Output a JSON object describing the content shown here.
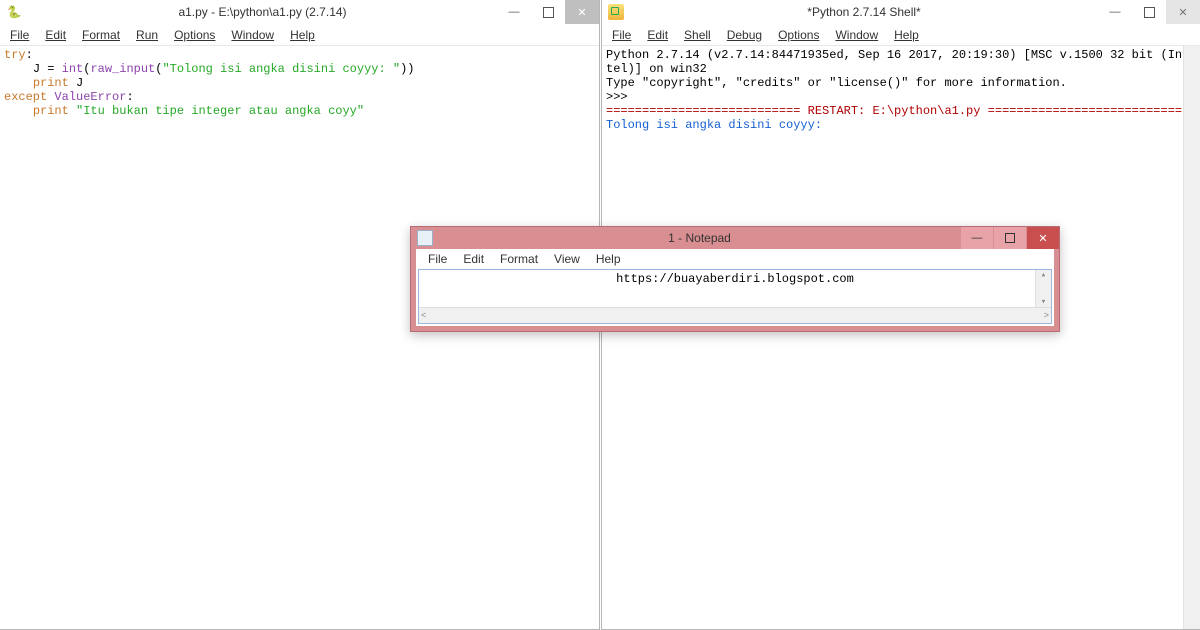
{
  "editor": {
    "title": "a1.py - E:\\python\\a1.py (2.7.14)",
    "menu": [
      "File",
      "Edit",
      "Format",
      "Run",
      "Options",
      "Window",
      "Help"
    ],
    "code": {
      "l1_kw": "try",
      "l1_tail": ":",
      "indent": "    ",
      "l2a": "J = ",
      "l2_int": "int",
      "l2_paren1": "(",
      "l2_raw": "raw_input",
      "l2_paren2": "(",
      "l2_str": "\"Tolong isi angka disini coyyy: \"",
      "l2_paren3": "))",
      "l3_print": "print",
      "l3_tail": " J",
      "l4_except": "except",
      "l4_sp": " ",
      "l4_err": "ValueError",
      "l4_tail": ":",
      "l5_print": "print",
      "l5_sp": " ",
      "l5_str": "\"Itu bukan tipe integer atau angka coyy\""
    }
  },
  "shell": {
    "title": "*Python 2.7.14 Shell*",
    "menu": [
      "File",
      "Edit",
      "Shell",
      "Debug",
      "Options",
      "Window",
      "Help"
    ],
    "banner1": "Python 2.7.14 (v2.7.14:84471935ed, Sep 16 2017, 20:19:30) [MSC v.1500 32 bit (In",
    "banner2": "tel)] on win32",
    "banner3": "Type \"copyright\", \"credits\" or \"license()\" for more information.",
    "prompt": ">>> ",
    "restart": "=========================== RESTART: E:\\python\\a1.py ===========================",
    "inputline": "Tolong isi angka disini coyyy: "
  },
  "notepad": {
    "title": "1 - Notepad",
    "menu": [
      "File",
      "Edit",
      "Format",
      "View",
      "Help"
    ],
    "content": "https://buayaberdiri.blogspot.com"
  },
  "winbuttons": {
    "min": "—",
    "close": "✕"
  },
  "scroll": {
    "up": "▴",
    "down": "▾",
    "left": "<",
    "right": ">"
  }
}
